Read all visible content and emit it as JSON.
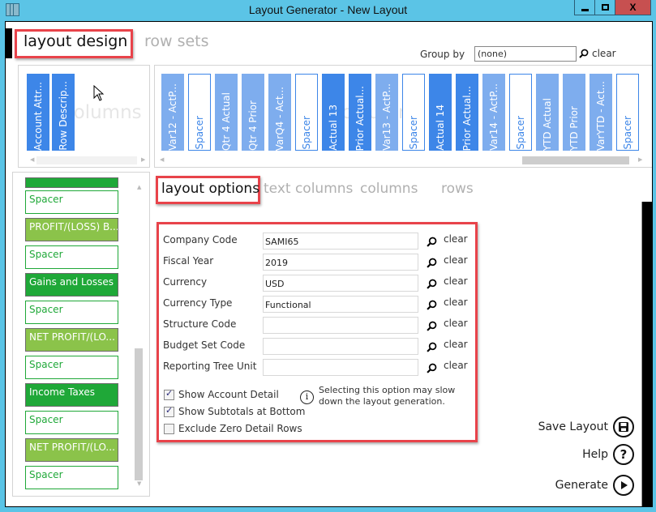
{
  "window": {
    "title": "Layout Generator - New Layout",
    "controls": {
      "minimize": "minimize",
      "maximize": "maximize",
      "close": "X"
    }
  },
  "main_tabs": [
    {
      "label": "layout design",
      "active": true
    },
    {
      "label": "row sets",
      "active": false
    }
  ],
  "group_by": {
    "label": "Group by",
    "value": "(none)",
    "clear_label": "clear"
  },
  "text_columns": {
    "watermark": "columns",
    "items": [
      {
        "label": "Account Attr...",
        "style": "dark"
      },
      {
        "label": "Row Descrip...",
        "style": "dark"
      }
    ]
  },
  "columns": {
    "watermark": "columns",
    "items": [
      {
        "label": "Var12 - ActP...",
        "style": "light"
      },
      {
        "label": "Spacer",
        "style": "spacer"
      },
      {
        "label": "Qtr 4 Actual",
        "style": "light"
      },
      {
        "label": "Qtr 4 Prior",
        "style": "light"
      },
      {
        "label": "VarQ4 - Act...",
        "style": "light"
      },
      {
        "label": "Spacer",
        "style": "spacer"
      },
      {
        "label": "Actual 13",
        "style": "dark"
      },
      {
        "label": "Prior Actual...",
        "style": "dark"
      },
      {
        "label": "Var13 - ActP...",
        "style": "light"
      },
      {
        "label": "Spacer",
        "style": "spacer"
      },
      {
        "label": "Actual 14",
        "style": "dark"
      },
      {
        "label": "Prior Actual...",
        "style": "dark"
      },
      {
        "label": "Var14 - ActP...",
        "style": "light"
      },
      {
        "label": "Spacer",
        "style": "spacer"
      },
      {
        "label": "YTD Actual",
        "style": "light"
      },
      {
        "label": "YTD Prior",
        "style": "light"
      },
      {
        "label": "VarYTD - Act...",
        "style": "light"
      },
      {
        "label": "Spacer",
        "style": "spacer"
      }
    ]
  },
  "rows": {
    "items": [
      {
        "label": "",
        "style": "green-dark"
      },
      {
        "label": "Spacer",
        "style": "spacer"
      },
      {
        "label": "PROFIT/(LOSS) B...",
        "style": "green-light"
      },
      {
        "label": "Spacer",
        "style": "spacer"
      },
      {
        "label": "Gains and Losses",
        "style": "green-dark"
      },
      {
        "label": "Spacer",
        "style": "spacer"
      },
      {
        "label": "NET PROFIT/(LO...",
        "style": "green-light"
      },
      {
        "label": "Spacer",
        "style": "spacer"
      },
      {
        "label": "Income Taxes",
        "style": "green-dark"
      },
      {
        "label": "Spacer",
        "style": "spacer"
      },
      {
        "label": "NET PROFIT/(LO...",
        "style": "green-light"
      },
      {
        "label": "Spacer",
        "style": "spacer"
      }
    ]
  },
  "sub_tabs": [
    {
      "label": "layout options",
      "active": true
    },
    {
      "label": "text columns",
      "active": false
    },
    {
      "label": "columns",
      "active": false
    },
    {
      "label": "rows",
      "active": false
    }
  ],
  "options": {
    "fields": [
      {
        "label": "Company Code",
        "value": "SAMI65",
        "clear": "clear"
      },
      {
        "label": "Fiscal Year",
        "value": "2019",
        "clear": "clear"
      },
      {
        "label": "Currency",
        "value": "USD",
        "clear": "clear"
      },
      {
        "label": "Currency Type",
        "value": "Functional",
        "clear": "clear"
      },
      {
        "label": "Structure Code",
        "value": "",
        "clear": "clear"
      },
      {
        "label": "Budget Set Code",
        "value": "",
        "clear": "clear"
      },
      {
        "label": "Reporting Tree Unit",
        "value": "",
        "clear": "clear"
      }
    ],
    "checkboxes": [
      {
        "label": "Show Account Detail",
        "checked": true
      },
      {
        "label": "Show Subtotals at Bottom",
        "checked": true
      },
      {
        "label": "Exclude Zero Detail Rows",
        "checked": false
      }
    ],
    "info_text": "Selecting this option may slow down the layout generation."
  },
  "actions": {
    "save": "Save Layout",
    "help": "Help",
    "generate": "Generate"
  },
  "colors": {
    "accent_blue": "#3d86e8",
    "light_blue": "#7eadee",
    "green_dark": "#1fa838",
    "green_light": "#8bc34a",
    "highlight_red": "#e8434a",
    "titlebar": "#5bc4e6",
    "close_red": "#c75050"
  }
}
